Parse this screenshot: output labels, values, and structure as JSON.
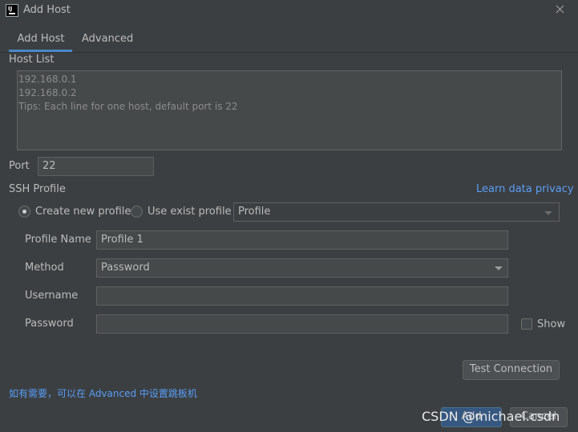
{
  "window": {
    "title": "Add Host",
    "icon": "intellij-icon",
    "icon_text": "IJ"
  },
  "tabs": [
    {
      "label": "Add Host",
      "active": true
    },
    {
      "label": "Advanced",
      "active": false
    }
  ],
  "host_list": {
    "label": "Host List",
    "placeholder_lines": [
      "192.168.0.1",
      "192.168.0.2",
      "Tips: Each line for one host, default port is 22"
    ]
  },
  "port": {
    "label": "Port",
    "value": "22"
  },
  "ssh_profile": {
    "label": "SSH Profile",
    "privacy_link": "Learn data privacy",
    "create_new_label": "Create new profile",
    "use_exist_label": "Use exist profile",
    "profile_select": "Profile"
  },
  "form": {
    "profile_name_label": "Profile Name",
    "profile_name_value": "Profile 1",
    "method_label": "Method",
    "method_value": "Password",
    "username_label": "Username",
    "username_value": "",
    "password_label": "Password",
    "password_value": "",
    "show_label": "Show"
  },
  "buttons": {
    "test_connection": "Test Connection",
    "add": "Add",
    "cancel": "Cancel"
  },
  "hint": "如有需要，可以在 Advanced 中设置跳板机",
  "watermark": "CSDN @michael.csdn",
  "colors": {
    "accent": "#4a88c7",
    "link": "#589df6",
    "background": "#3c3f41"
  }
}
